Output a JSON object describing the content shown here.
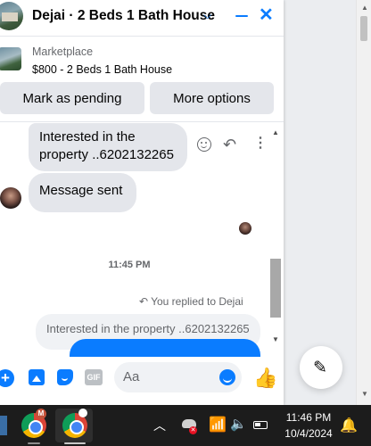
{
  "header": {
    "title": "Dejai · 2 Beds 1 Bath House",
    "chevron_icon": "chevron-down-icon",
    "minimize_icon": "minimize-icon",
    "close_icon": "close-icon"
  },
  "listing": {
    "label": "Marketplace",
    "detail": "$800 - 2 Beds 1 Bath House"
  },
  "actions": {
    "mark_pending": "Mark as pending",
    "more_options": "More options"
  },
  "messages": {
    "incoming_1": "Interested in the property ..6202132265",
    "incoming_2": "Message sent",
    "timestamp": "11:45 PM",
    "replied_label": "You replied to Dejai",
    "quoted_text": "Interested in the property ..6202132265"
  },
  "composer": {
    "placeholder": "Aa"
  },
  "taskbar": {
    "chrome_badge": "M",
    "time": "11:46 PM",
    "date": "10/4/2024"
  },
  "colors": {
    "accent": "#0a7cff",
    "bubble_incoming": "#e4e6eb",
    "taskbar": "#1c1c1c"
  }
}
